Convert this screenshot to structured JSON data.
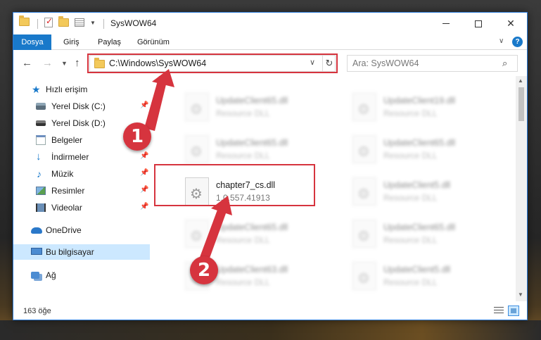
{
  "window": {
    "title": "SysWOW64",
    "minimize_label": "",
    "maximize_label": "",
    "close_label": "✕"
  },
  "ribbon": {
    "tabs": [
      "Dosya",
      "Giriş",
      "Paylaş",
      "Görünüm"
    ],
    "help": "?"
  },
  "nav": {
    "address": "C:\\Windows\\SysWOW64",
    "search_placeholder": "Ara: SysWOW64"
  },
  "sidebar": {
    "items": [
      {
        "label": "Hızlı erişim"
      },
      {
        "label": "Yerel Disk (C:)"
      },
      {
        "label": "Yerel Disk (D:)"
      },
      {
        "label": "Belgeler"
      },
      {
        "label": "İndirmeler"
      },
      {
        "label": "Müzik"
      },
      {
        "label": "Resimler"
      },
      {
        "label": "Videolar"
      },
      {
        "label": "OneDrive"
      },
      {
        "label": "Bu bilgisayar"
      },
      {
        "label": "Ağ"
      }
    ]
  },
  "files": [
    {
      "name": "UpdateClient65.dll",
      "sub": "Resource DLL"
    },
    {
      "name": "UpdateClient19.dll",
      "sub": "Resource DLL"
    },
    {
      "name": "UpdateClient65.dll",
      "sub": "Resource DLL"
    },
    {
      "name": "UpdateClient65.dll",
      "sub": "Resource DLL"
    },
    {
      "name": "chapter7_cs.dll",
      "sub": "1.0.557.41913"
    },
    {
      "name": "UpdateClient5.dll",
      "sub": "Resource DLL"
    },
    {
      "name": "UpdateClient65.dll",
      "sub": "Resource DLL"
    },
    {
      "name": "UpdateClient65.dll",
      "sub": "Resource DLL"
    },
    {
      "name": "UpdateClient63.dll",
      "sub": "Resource DLL"
    },
    {
      "name": "UpdateClient5.dll",
      "sub": "Resource DLL"
    }
  ],
  "status": {
    "count": "163 öğe"
  },
  "annotations": {
    "step1": "1",
    "step2": "2",
    "color": "#d6343e"
  }
}
